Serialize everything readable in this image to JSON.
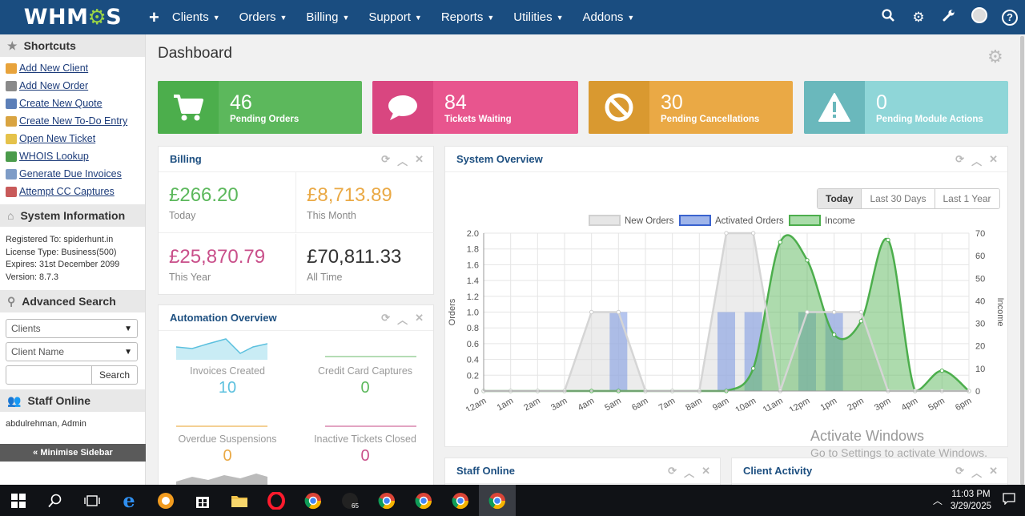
{
  "nav": {
    "logo": "WHMCS",
    "items": [
      {
        "label": "Clients"
      },
      {
        "label": "Orders"
      },
      {
        "label": "Billing"
      },
      {
        "label": "Support"
      },
      {
        "label": "Reports"
      },
      {
        "label": "Utilities"
      },
      {
        "label": "Addons"
      }
    ],
    "right_icons": [
      "search-icon",
      "cogs-icon",
      "wrench-icon",
      "avatar",
      "help-icon"
    ],
    "help_glyph": "?"
  },
  "sidebar": {
    "shortcuts_title": "Shortcuts",
    "shortcuts": [
      {
        "label": "Add New Client",
        "color": "#e8a33b"
      },
      {
        "label": "Add New Order",
        "color": "#8a8a8a"
      },
      {
        "label": "Create New Quote",
        "color": "#5c7fb8"
      },
      {
        "label": "Create New To-Do Entry",
        "color": "#d9a441"
      },
      {
        "label": "Open New Ticket",
        "color": "#e5c24a"
      },
      {
        "label": "WHOIS Lookup",
        "color": "#4a9b4a"
      },
      {
        "label": "Generate Due Invoices",
        "color": "#7e9cc7"
      },
      {
        "label": "Attempt CC Captures",
        "color": "#c85a5a"
      }
    ],
    "system_info_title": "System Information",
    "system_info": {
      "registered": "Registered To: spiderhunt.in",
      "license": "License Type: Business(500)",
      "expires": "Expires: 31st December 2099",
      "version": "Version: 8.7.3"
    },
    "advanced_search_title": "Advanced Search",
    "search_type": "Clients",
    "search_field": "Client Name",
    "search_button": "Search",
    "staff_online_title": "Staff Online",
    "staff_online": "abdulrehman, Admin",
    "minimise": "« Minimise Sidebar"
  },
  "main": {
    "title": "Dashboard",
    "stats": [
      {
        "value": "46",
        "label": "Pending Orders",
        "color": "#5cb85c",
        "dark": "#4cae4c",
        "icon": "cart-icon"
      },
      {
        "value": "84",
        "label": "Tickets Waiting",
        "color": "#e8558e",
        "dark": "#d94680",
        "icon": "comment-icon"
      },
      {
        "value": "30",
        "label": "Pending Cancellations",
        "color": "#eaa945",
        "dark": "#d99930",
        "icon": "ban-icon"
      },
      {
        "value": "0",
        "label": "Pending Module Actions",
        "color": "#8fd6d8",
        "dark": "#6ab8bc",
        "icon": "warning-icon"
      }
    ],
    "billing": {
      "title": "Billing",
      "cells": [
        {
          "value": "£266.20",
          "label": "Today",
          "color": "#5cb85c"
        },
        {
          "value": "£8,713.89",
          "label": "This Month",
          "color": "#eaa945"
        },
        {
          "value": "£25,870.79",
          "label": "This Year",
          "color": "#c94f8a"
        },
        {
          "value": "£70,811.33",
          "label": "All Time",
          "color": "#333333"
        }
      ]
    },
    "automation": {
      "title": "Automation Overview",
      "cells": [
        {
          "label": "Invoices Created",
          "value": "10",
          "color": "#5bc0de"
        },
        {
          "label": "Credit Card Captures",
          "value": "0",
          "color": "#5cb85c"
        },
        {
          "label": "Overdue Suspensions",
          "value": "0",
          "color": "#eaa945"
        },
        {
          "label": "Inactive Tickets Closed",
          "value": "0",
          "color": "#c94f8a"
        }
      ]
    },
    "overview": {
      "title": "System Overview",
      "ranges": [
        "Today",
        "Last 30 Days",
        "Last 1 Year"
      ],
      "active_range": "Today"
    },
    "staff_panel_title": "Staff Online",
    "client_activity_title": "Client Activity",
    "watermark_title": "Activate Windows",
    "watermark_sub": "Go to Settings to activate Windows."
  },
  "chart_data": {
    "type": "bar",
    "categories": [
      "12am",
      "1am",
      "2am",
      "3am",
      "4am",
      "5am",
      "6am",
      "7am",
      "8am",
      "9am",
      "10am",
      "11am",
      "12pm",
      "1pm",
      "2pm",
      "3pm",
      "4pm",
      "5pm",
      "6pm"
    ],
    "series": [
      {
        "name": "New Orders",
        "type": "area",
        "axis": "left",
        "color": "#dddddd",
        "values": [
          0,
          0,
          0,
          0,
          1,
          1,
          0,
          0,
          0,
          2,
          2,
          0,
          1,
          1,
          1,
          0,
          0,
          0,
          0
        ]
      },
      {
        "name": "Activated Orders",
        "type": "bar",
        "axis": "left",
        "color": "#7b9be0",
        "values": [
          0,
          0,
          0,
          0,
          0,
          1,
          0,
          0,
          0,
          1,
          1,
          0,
          1,
          1,
          0,
          0,
          0,
          0,
          0
        ]
      },
      {
        "name": "Income",
        "type": "area",
        "axis": "right",
        "color": "#5cb85c",
        "values": [
          0,
          0,
          0,
          0,
          0,
          0,
          0,
          0,
          0,
          0,
          10,
          66,
          58,
          25,
          31,
          67,
          0,
          9,
          0
        ]
      }
    ],
    "ylabel": "Orders",
    "ylabel_right": "Income",
    "ylim": [
      0,
      2.0
    ],
    "ylim_right": [
      0,
      70
    ],
    "yticks": [
      "0",
      "0.2",
      "0.4",
      "0.6",
      "0.8",
      "1.0",
      "1.2",
      "1.4",
      "1.6",
      "1.8",
      "2.0"
    ],
    "yticks_right": [
      "0",
      "10",
      "20",
      "30",
      "40",
      "50",
      "60",
      "70"
    ],
    "grid": true,
    "legend": "top"
  },
  "taskbar": {
    "time": "11:03 PM",
    "date": "3/29/2025",
    "badge": "65"
  }
}
